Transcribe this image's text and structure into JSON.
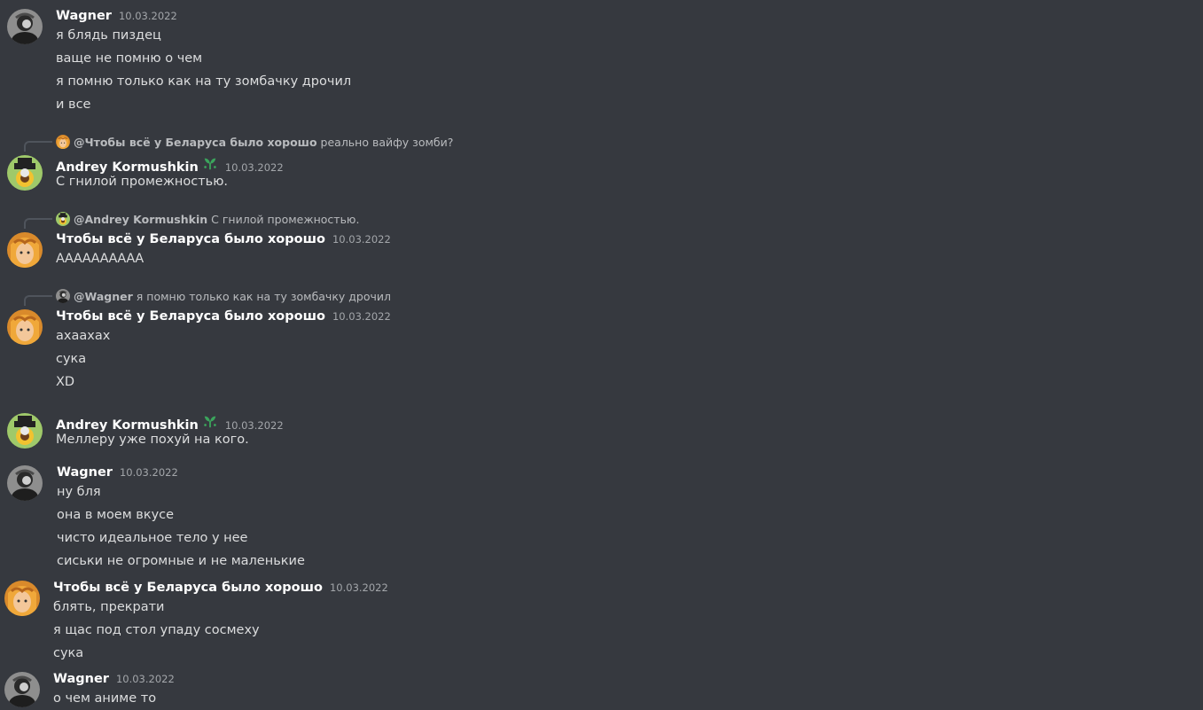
{
  "colors": {
    "background": "#36393f",
    "author": "#ffffff",
    "timestamp": "#a3a6aa",
    "text": "#dcddde",
    "badge": "#3ba55c"
  },
  "messages": [
    {
      "author": "Wagner",
      "timestamp": "10.03.2022",
      "avatar": "wagner-avatar",
      "lines": [
        "я блядь пиздец",
        "ваще не помню о чем",
        "я помню только как на ту зомбачку дрочил",
        "и все"
      ]
    },
    {
      "reply": {
        "name": "@Чтобы всё у Беларуса было хорошо",
        "text": "реально вайфу зомби?"
      },
      "author": "Andrey Kormushkin",
      "timestamp": "10.03.2022",
      "avatar": "andrey-avatar",
      "badge": "seedling-icon",
      "lines": [
        "С гнилой промежностью."
      ]
    },
    {
      "reply": {
        "name": "@Andrey Kormushkin",
        "text": "С гнилой промежностью."
      },
      "author": "Чтобы всё у Беларуса было хорошо",
      "timestamp": "10.03.2022",
      "avatar": "belarus-avatar",
      "lines": [
        "АААААААААА"
      ]
    },
    {
      "reply": {
        "name": "@Wagner",
        "text": "я помню только как на ту зомбачку дрочил"
      },
      "author": "Чтобы всё у Беларуса было хорошо",
      "timestamp": "10.03.2022",
      "avatar": "belarus-avatar",
      "lines": [
        "ахаахах",
        "сука",
        "XD"
      ]
    },
    {
      "author": "Andrey Kormushkin",
      "timestamp": "10.03.2022",
      "avatar": "andrey-avatar",
      "badge": "seedling-icon",
      "lines": [
        "Меллеру уже похуй на кого."
      ]
    },
    {
      "author": "Wagner",
      "timestamp": "10.03.2022",
      "avatar": "wagner-avatar",
      "lines": [
        "ну бля",
        "она в моем вкусе",
        "чисто идеальное тело у нее",
        "сиськи не огромные и не маленькие"
      ]
    },
    {
      "author": "Чтобы всё у Беларуса было хорошо",
      "timestamp": "10.03.2022",
      "avatar": "belarus-avatar",
      "lines": [
        "блять, прекрати",
        "я щас под стол упаду сосмеху",
        "сука"
      ]
    },
    {
      "author": "Wagner",
      "timestamp": "10.03.2022",
      "avatar": "wagner-avatar",
      "lines": [
        "о чем аниме то"
      ]
    }
  ]
}
